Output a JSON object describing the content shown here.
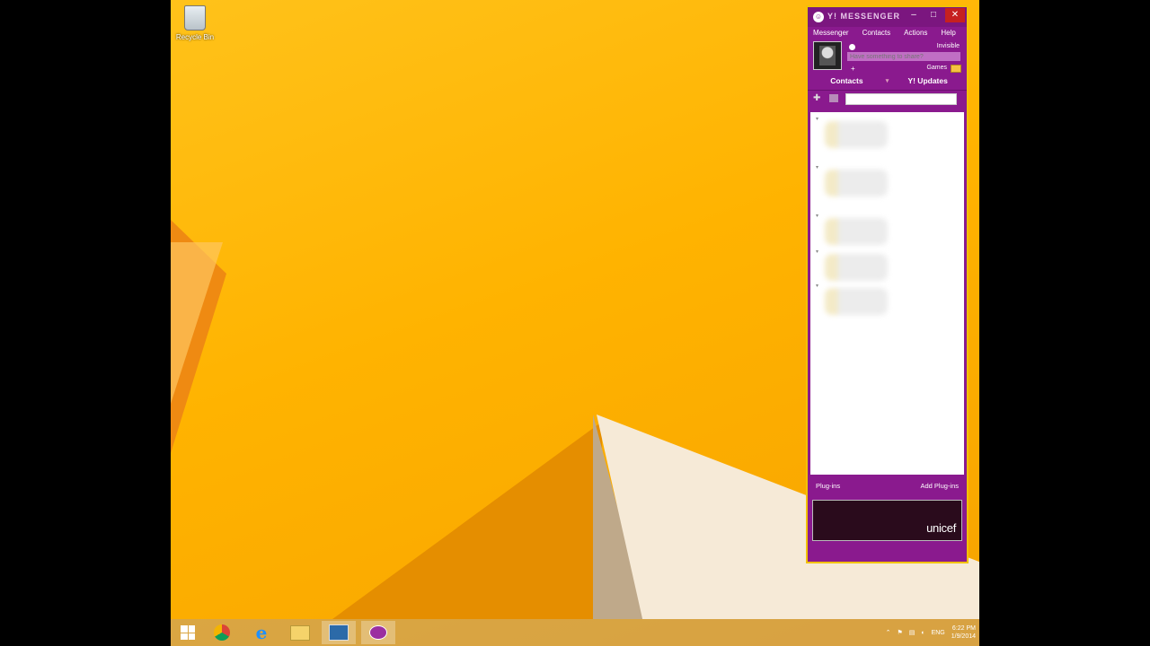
{
  "desktop": {
    "recycle_bin_label": "Recycle Bin"
  },
  "messenger": {
    "title": "Y! MESSENGER",
    "window_buttons": {
      "minimize": "–",
      "maximize": "□",
      "close": "✕"
    },
    "menu": [
      "Messenger",
      "Contacts",
      "Actions",
      "Help"
    ],
    "status_mode": "Invisible",
    "share_placeholder": "Have something to share?",
    "add_status": "+",
    "games_label": "Games",
    "tabs": {
      "contacts": "Contacts",
      "updates": "Y! Updates",
      "separator": "▾"
    },
    "search_placeholder": "",
    "plugins_label": "Plug-ins",
    "add_plugins_label": "Add Plug-ins",
    "ad_text": "unicef"
  },
  "taskbar": {
    "apps": [
      "start-icon",
      "chrome-icon",
      "ie-icon",
      "file-explorer-icon",
      "remote-desktop-icon",
      "messenger-icon"
    ],
    "language": "ENG",
    "time": "6:22 PM",
    "date": "1/9/2014"
  }
}
